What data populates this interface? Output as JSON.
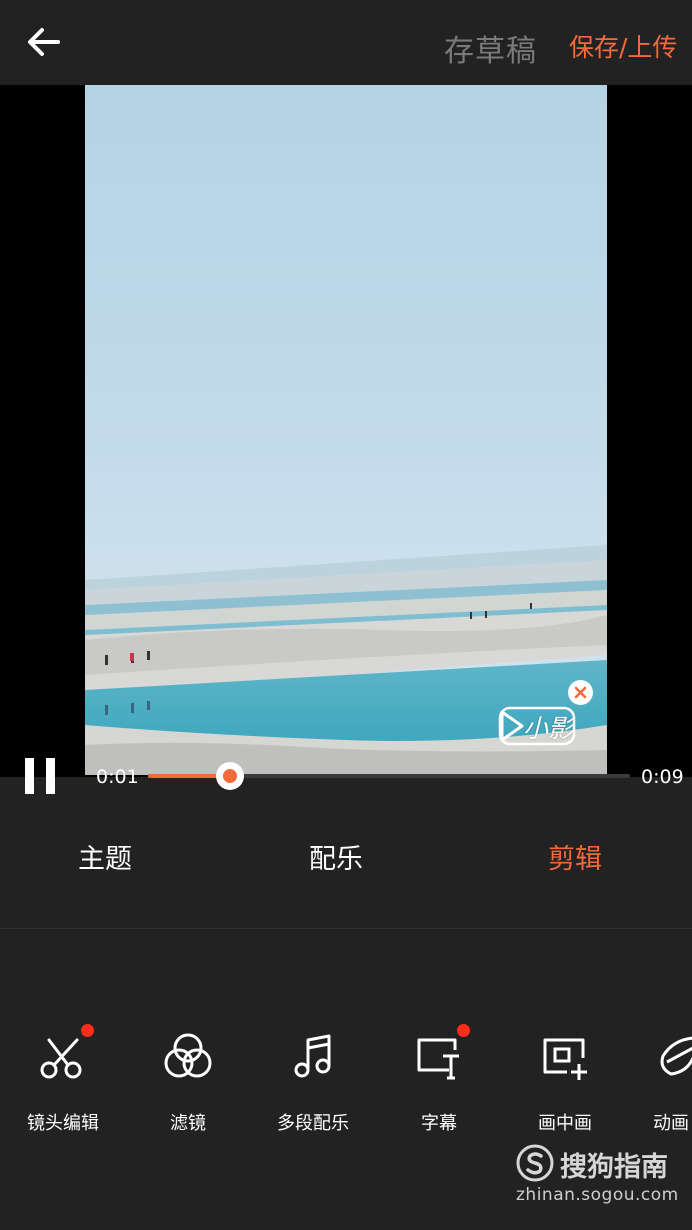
{
  "topbar": {
    "back_icon": "arrow-left-icon",
    "draft_label": "存草稿",
    "save_label": "保存/上传"
  },
  "watermark": {
    "text": "小影",
    "close_icon": "close-icon"
  },
  "player": {
    "current_time": "0:01",
    "total_time": "0:09",
    "progress": 0.17,
    "state_icon": "pause-icon"
  },
  "tabs": [
    {
      "label": "主题",
      "active": false
    },
    {
      "label": "配乐",
      "active": false
    },
    {
      "label": "剪辑",
      "active": true
    }
  ],
  "tools": [
    {
      "label": "镜头编辑",
      "icon": "scissors-icon",
      "badge": true
    },
    {
      "label": "滤镜",
      "icon": "filter-circles-icon",
      "badge": false
    },
    {
      "label": "多段配乐",
      "icon": "music-note-icon",
      "badge": false
    },
    {
      "label": "字幕",
      "icon": "subtitle-icon",
      "badge": true
    },
    {
      "label": "画中画",
      "icon": "picture-in-picture-icon",
      "badge": false
    },
    {
      "label": "动画",
      "icon": "animation-icon",
      "badge": false
    }
  ],
  "sogou": {
    "brand": "搜狗指南",
    "url": "zhinan.sogou.com"
  },
  "colors": {
    "accent": "#f46a3a",
    "badge": "#ff2d1a",
    "background": "#222222"
  }
}
